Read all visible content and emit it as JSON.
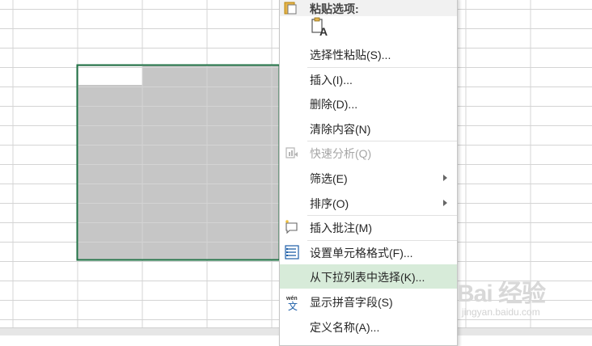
{
  "colors": {
    "gridline": "#d4d4d4",
    "selection_fill": "#c6c6c6",
    "selection_border": "#217346",
    "menu_highlight": "#d7ebd9"
  },
  "context_menu": {
    "header": "粘贴选项:",
    "paste_option_icon": "paste-text-only-icon",
    "items": [
      {
        "name": "paste-special",
        "label": "选择性粘贴(S)...",
        "icon": ""
      },
      {
        "name": "insert",
        "label": "插入(I)...",
        "icon": ""
      },
      {
        "name": "delete",
        "label": "删除(D)...",
        "icon": ""
      },
      {
        "name": "clear-contents",
        "label": "清除内容(N)",
        "icon": ""
      },
      {
        "name": "quick-analysis",
        "label": "快速分析(Q)",
        "icon": "quick-analysis-icon",
        "disabled": true
      },
      {
        "name": "filter",
        "label": "筛选(E)",
        "icon": "",
        "submenu": true
      },
      {
        "name": "sort",
        "label": "排序(O)",
        "icon": "",
        "submenu": true
      },
      {
        "name": "insert-comment",
        "label": "插入批注(M)",
        "icon": "comment-icon"
      },
      {
        "name": "format-cells",
        "label": "设置单元格格式(F)...",
        "icon": "format-cells-icon"
      },
      {
        "name": "pick-from-dropdown",
        "label": "从下拉列表中选择(K)...",
        "icon": "",
        "highlighted": true
      },
      {
        "name": "show-phonetic",
        "label": "显示拼音字段(S)",
        "icon": "phonetic-icon"
      },
      {
        "name": "define-name",
        "label": "定义名称(A)...",
        "icon": ""
      }
    ]
  },
  "watermark": {
    "text": "Bai 经验",
    "url": "jingyan.baidu.com"
  }
}
